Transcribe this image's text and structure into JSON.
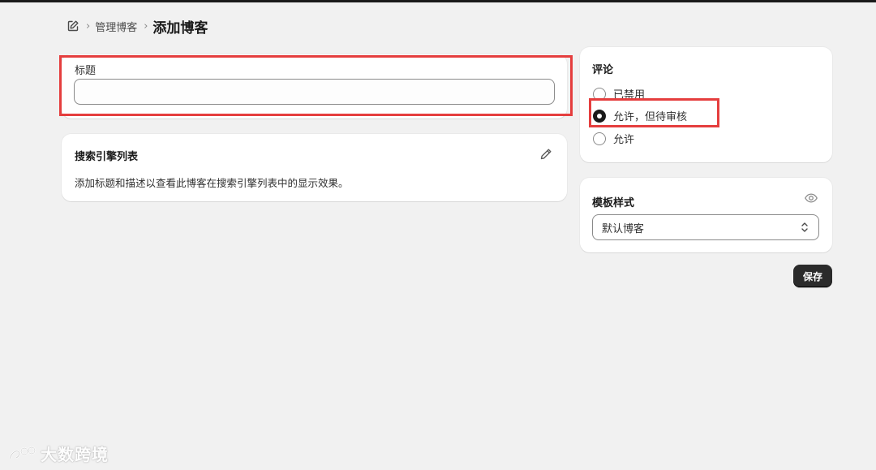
{
  "breadcrumb": {
    "icon": "edit-square-icon",
    "parent": "管理博客",
    "current": "添加博客"
  },
  "title_card": {
    "label": "标题",
    "value": "",
    "placeholder": ""
  },
  "seo_card": {
    "title": "搜索引擎列表",
    "edit_icon": "pencil-icon",
    "description": "添加标题和描述以查看此博客在搜索引擎列表中的显示效果。"
  },
  "comments": {
    "title": "评论",
    "options": [
      {
        "label": "已禁用",
        "checked": false
      },
      {
        "label": "允许，但待审核",
        "checked": true
      },
      {
        "label": "允许",
        "checked": false
      }
    ]
  },
  "template": {
    "title": "模板样式",
    "eye_icon": "eye-icon",
    "selected": "默认博客"
  },
  "actions": {
    "save_label": "保存"
  },
  "watermark": {
    "text": "大数跨境"
  },
  "colors": {
    "background": "#f1f1f1",
    "annotation": "#e53e3e",
    "primary_button": "#2b2b2b"
  }
}
